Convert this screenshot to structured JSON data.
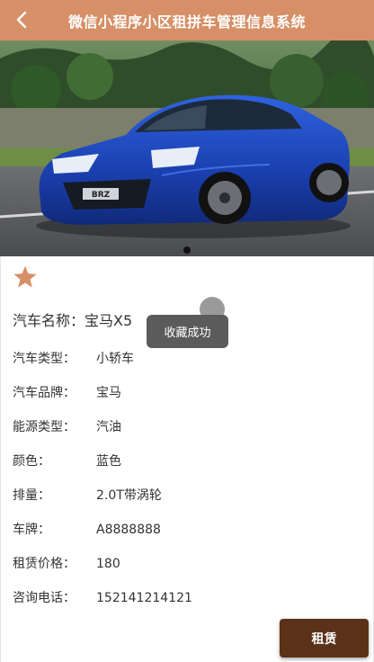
{
  "header": {
    "title": "微信小程序小区租拼车管理信息系统",
    "back_icon": "chevron-left-icon",
    "color": "#d68f66"
  },
  "detail": {
    "name_label": "汽车名称：",
    "name_value": "宝马X5",
    "favorite_icon": "star-icon",
    "favorite_color": "#d68f66",
    "fields": [
      {
        "label": "汽车类型：",
        "value": "小轿车"
      },
      {
        "label": "汽车品牌：",
        "value": "宝马"
      },
      {
        "label": "能源类型：",
        "value": "汽油"
      },
      {
        "label": "颜色：",
        "value": "蓝色"
      },
      {
        "label": "排量：",
        "value": "2.0T带涡轮"
      },
      {
        "label": "车牌：",
        "value": "A8888888"
      },
      {
        "label": "租赁价格：",
        "value": "180"
      },
      {
        "label": "咨询电话：",
        "value": "152141214121"
      }
    ]
  },
  "toast": {
    "text": "收藏成功"
  },
  "actions": {
    "rent_label": "租赁",
    "rent_color": "#5a3217"
  }
}
